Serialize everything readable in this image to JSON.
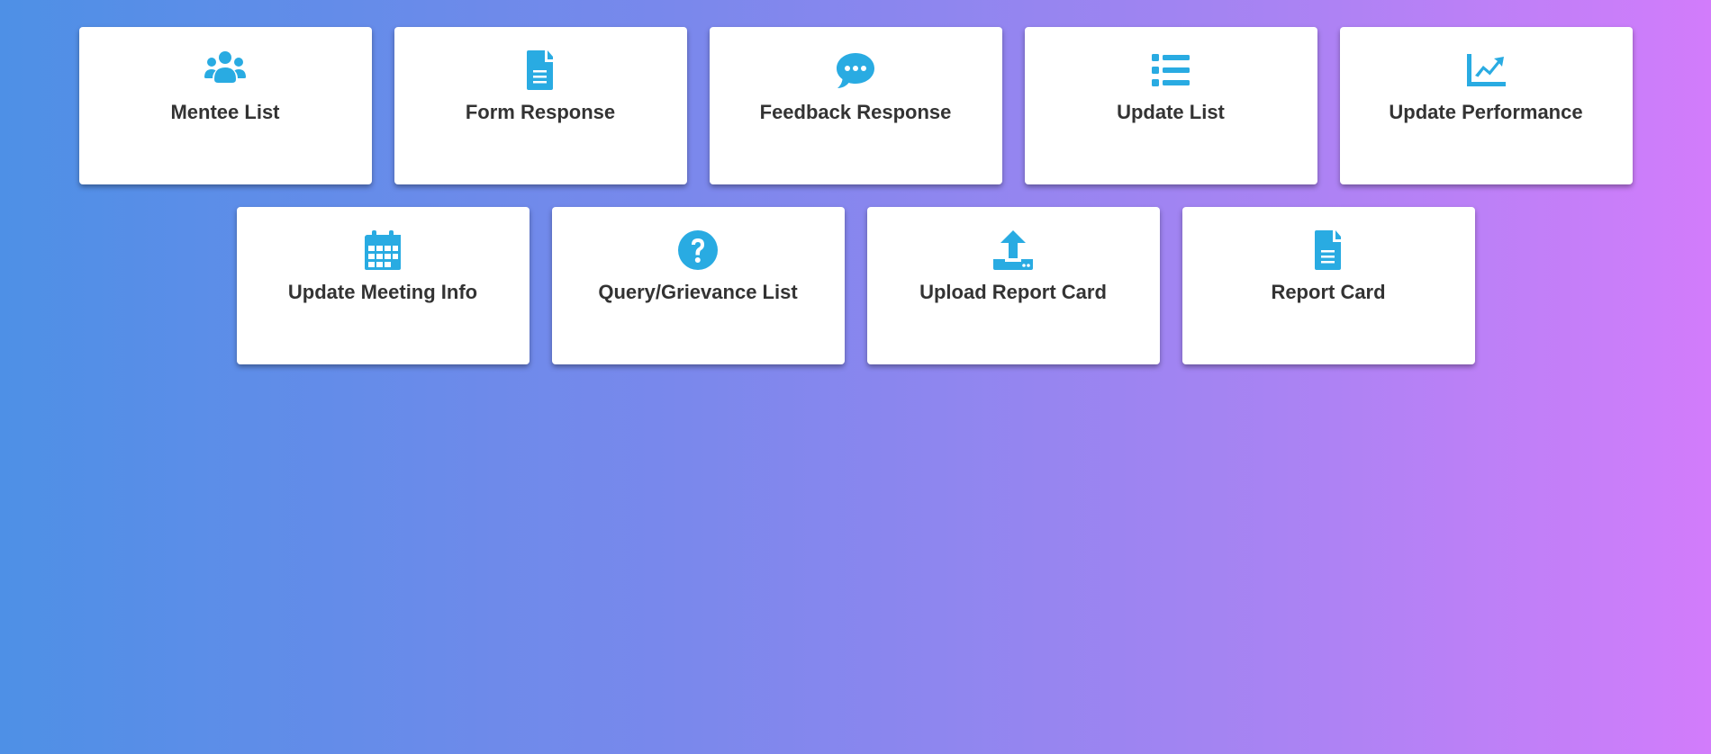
{
  "theme": {
    "icon_color": "#29abe2",
    "card_color": "#ffffff",
    "text_color": "#333333",
    "gradient_start": "#4e90e6",
    "gradient_end": "#d27cfb"
  },
  "tiles": [
    {
      "label": "Mentee List",
      "icon": "users-icon"
    },
    {
      "label": "Form Response",
      "icon": "document-icon"
    },
    {
      "label": "Feedback Response",
      "icon": "comment-dots-icon"
    },
    {
      "label": "Update List",
      "icon": "list-icon"
    },
    {
      "label": "Update Performance",
      "icon": "chart-line-icon"
    },
    {
      "label": "Update Meeting Info",
      "icon": "calendar-icon"
    },
    {
      "label": "Query/Grievance List",
      "icon": "question-circle-icon"
    },
    {
      "label": "Upload Report Card",
      "icon": "upload-icon"
    },
    {
      "label": "Report Card",
      "icon": "document-icon"
    }
  ]
}
